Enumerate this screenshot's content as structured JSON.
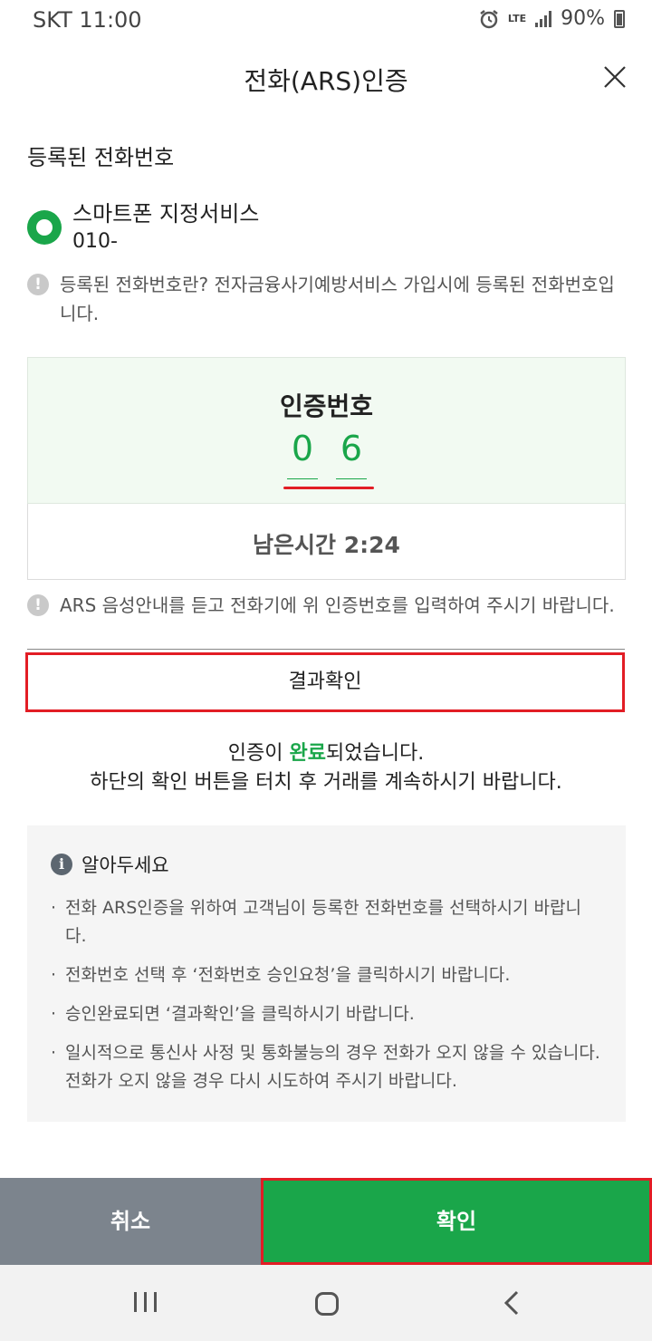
{
  "status_bar": {
    "carrier_time": "SKT 11:00",
    "network": "LTE",
    "battery": "90%"
  },
  "header": {
    "title": "전화(ARS)인증"
  },
  "phone_section": {
    "title": "등록된 전화번호",
    "option_label": "스마트폰 지정서비스",
    "option_phone": "010-",
    "notice": "등록된 전화번호란? 전자금융사기예방서비스 가입시에 등록된 전화번호입니다."
  },
  "auth_code": {
    "title": "인증번호",
    "digits": [
      "0",
      "6"
    ]
  },
  "timer": {
    "text": "남은시간 2:24"
  },
  "ars_notice": "ARS 음성안내를 듣고 전화기에 위 인증번호를 입력하여 주시기 바랍니다.",
  "result_button": "결과확인",
  "completion": {
    "prefix": "인증이 ",
    "highlight": "완료",
    "suffix": "되었습니다.",
    "line2": "하단의 확인 버튼을 터치 후 거래를 계속하시기 바랍니다."
  },
  "info": {
    "title": "알아두세요",
    "items": [
      "전화 ARS인증을 위하여 고객님이 등록한 전화번호를 선택하시기 바랍니다.",
      "전화번호 선택 후 ‘전화번호 승인요청’을 클릭하시기 바랍니다.",
      "승인완료되면 ‘결과확인’을 클릭하시기 바랍니다.",
      "일시적으로 통신사 사정 및 통화불능의 경우 전화가 오지 않을 수 있습니다. 전화가 오지 않을 경우 다시 시도하여 주시기 바랍니다."
    ]
  },
  "footer": {
    "cancel": "취소",
    "confirm": "확인"
  },
  "colors": {
    "accent_green": "#1aa64a",
    "highlight_red": "#e21d25",
    "cancel_gray": "#7c848d"
  }
}
